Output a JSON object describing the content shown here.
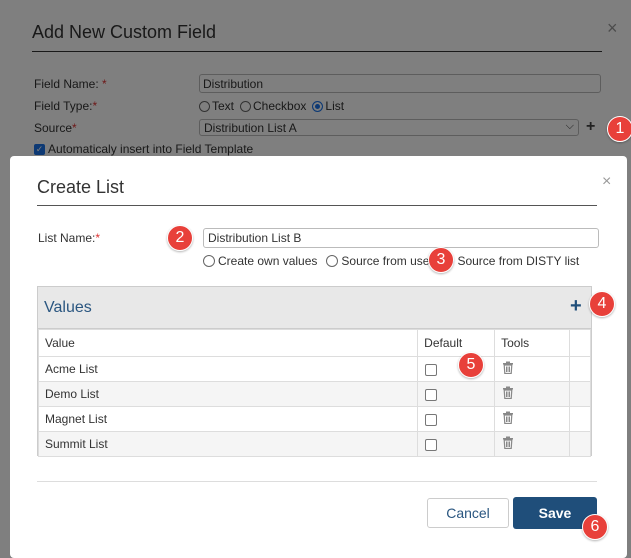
{
  "background_dialog": {
    "title": "Add New Custom Field",
    "close_label": "×",
    "field_name_label": "Field Name:",
    "field_name_value": "Distribution",
    "field_type_label": "Field Type:",
    "field_type_options": [
      "Text",
      "Checkbox",
      "List"
    ],
    "field_type_selected": "List",
    "source_label": "Source",
    "source_value": "Distribution List A",
    "source_add": "+",
    "auto_insert_label": "Automaticaly insert into Field Template",
    "required_mark": "*"
  },
  "dialog": {
    "title": "Create List",
    "close_label": "×",
    "list_name_label": "List Name:",
    "required_mark": "*",
    "list_name_value": "Distribution List B",
    "source_options": [
      "Create own values",
      "Source from user",
      "Source from DISTY list"
    ],
    "source_selected": "Source from DISTY list",
    "values_panel": {
      "title": "Values",
      "add_label": "+",
      "columns": [
        "Value",
        "Default",
        "Tools"
      ],
      "rows": [
        "Acme List",
        "Demo List",
        "Magnet List",
        "Summit List"
      ]
    },
    "cancel_label": "Cancel",
    "save_label": "Save"
  },
  "callouts": [
    "1",
    "2",
    "3",
    "4",
    "5",
    "6"
  ],
  "colors": {
    "accent": "#1f4e7a",
    "badge": "#e8403a",
    "required": "#dd3333"
  }
}
